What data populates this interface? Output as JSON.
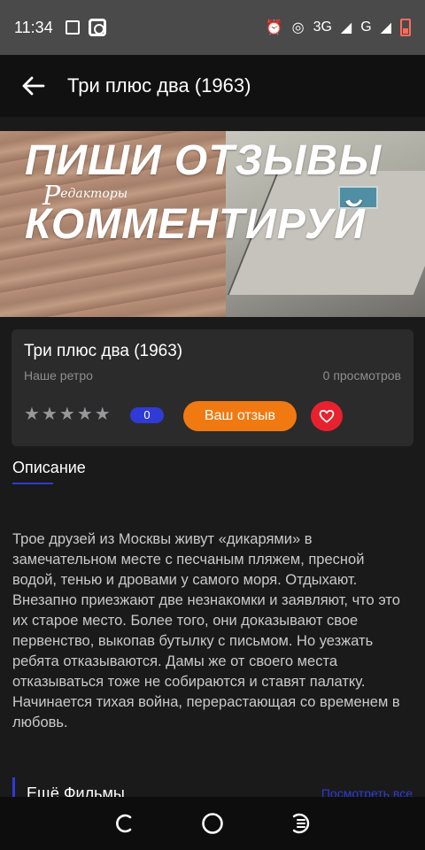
{
  "status_bar": {
    "time": "11:34",
    "network": "3G",
    "signal_label": "G"
  },
  "app_bar": {
    "back_icon": "arrow-left-icon",
    "title": "Три плюс два (1963)"
  },
  "hero": {
    "line1": "ПИШИ ОТЗЫВЫ",
    "line2": "КОММЕНТИРУЙ",
    "logo_letter": "Р",
    "logo_text": "едакторы"
  },
  "info_card": {
    "title": "Три плюс два (1963)",
    "channel": "Наше  ретро",
    "views": "0 просмотров",
    "stars": 5,
    "rating_count": "0",
    "review_button": "Ваш отзыв",
    "favorite_icon": "heart-icon"
  },
  "description": {
    "tab_label": "Описание",
    "text": "Трое друзей из Москвы живут «дикарями» в замечательном месте с песчаным пляжем, пресной водой, тенью и дровами у самого моря. Отдыхают. Внезапно приезжают две незнакомки и заявляют, что это их старое место. Более того, они доказывают свое первенство, выкопав бутылку с письмом. Но уезжать ребята отказываются. Дамы же от своего места отказываться тоже не собираются и ставят палатку. Начинается тихая война, перерастающая со временем в любовь."
  },
  "more": {
    "title": "Ещё Фильмы",
    "link": "Посмотреть все"
  },
  "colors": {
    "accent_blue": "#2f3bd4",
    "review_orange": "#f07a11",
    "favorite_red": "#e8212f",
    "card_bg": "#2b2b2b",
    "page_bg": "#1a1a1a"
  }
}
